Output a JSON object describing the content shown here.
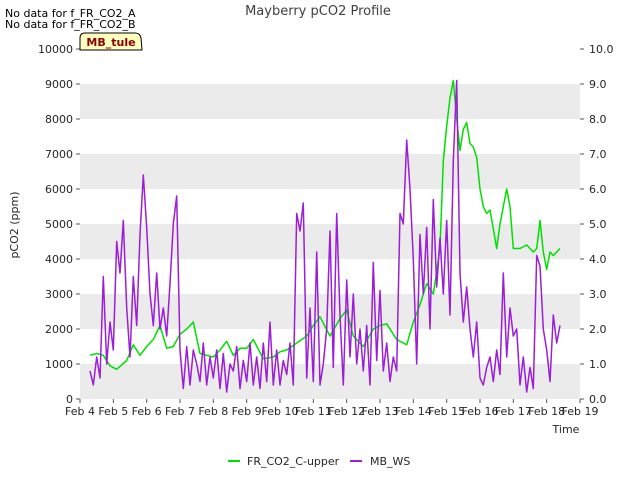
{
  "notices": [
    "No data for f_FR_CO2_A",
    "No data for f_FR_CO2_B"
  ],
  "site_label": "MB_tule",
  "chart_data": {
    "type": "line",
    "title": "Mayberry pCO2 Profile",
    "xlabel": "Time",
    "ylabel": "pCO2 (ppm)",
    "ylim": [
      0,
      10000
    ],
    "y2lim": [
      0.0,
      10.0
    ],
    "xlim": [
      4,
      19
    ],
    "x_ticks": [
      4,
      5,
      6,
      7,
      8,
      9,
      10,
      11,
      12,
      13,
      14,
      15,
      16,
      17,
      18,
      19
    ],
    "x_tick_labels": [
      "Feb 4",
      "Feb 5",
      "Feb 6",
      "Feb 7",
      "Feb 8",
      "Feb 9",
      "Feb 10",
      "Feb 11",
      "Feb 12",
      "Feb 13",
      "Feb 14",
      "Feb 15",
      "Feb 16",
      "Feb 17",
      "Feb 18",
      "Feb 19"
    ],
    "y_ticks": [
      0,
      1000,
      2000,
      3000,
      4000,
      5000,
      6000,
      7000,
      8000,
      9000,
      10000
    ],
    "y_tick_labels": [
      "0",
      "1000",
      "2000",
      "3000",
      "4000",
      "5000",
      "6000",
      "7000",
      "8000",
      "9000",
      "10000"
    ],
    "y2_ticks": [
      0,
      1,
      2,
      3,
      4,
      5,
      6,
      7,
      8,
      9,
      10
    ],
    "y2_tick_labels": [
      "0.0",
      "1.0",
      "2.0",
      "3.0",
      "4.0",
      "5.0",
      "6.0",
      "7.0",
      "8.0",
      "9.0",
      "10.0"
    ],
    "grid": "horizontal bands",
    "legend": "bottom",
    "colors": {
      "FR_CO2_C-upper": "#00e000",
      "MB_WS": "#9a1fd6",
      "band": "#ebebeb"
    },
    "series": [
      {
        "name": "FR_CO2_C-upper",
        "axis": "left",
        "x": [
          4.3,
          4.5,
          4.7,
          4.9,
          5.1,
          5.4,
          5.6,
          5.8,
          6.0,
          6.2,
          6.4,
          6.6,
          6.8,
          7.0,
          7.2,
          7.4,
          7.6,
          7.8,
          8.0,
          8.2,
          8.4,
          8.6,
          8.8,
          9.0,
          9.2,
          9.5,
          9.8,
          10.0,
          10.2,
          10.5,
          10.8,
          11.0,
          11.2,
          11.5,
          11.8,
          12.0,
          12.2,
          12.5,
          12.8,
          13.0,
          13.2,
          13.5,
          13.8,
          14.0,
          14.2,
          14.4,
          14.6,
          14.8,
          14.9,
          15.0,
          15.1,
          15.2,
          15.3,
          15.4,
          15.5,
          15.6,
          15.7,
          15.8,
          15.9,
          16.0,
          16.1,
          16.2,
          16.3,
          16.5,
          16.6,
          16.8,
          16.9,
          17.0,
          17.2,
          17.4,
          17.6,
          17.7,
          17.8,
          17.9,
          18.0,
          18.1,
          18.2,
          18.4
        ],
        "y": [
          1250,
          1300,
          1250,
          950,
          850,
          1100,
          1550,
          1250,
          1500,
          1700,
          2100,
          1450,
          1500,
          1850,
          2000,
          2200,
          1300,
          1250,
          1200,
          1400,
          1650,
          1250,
          1450,
          1450,
          1700,
          1150,
          1200,
          1350,
          1400,
          1600,
          1800,
          2100,
          2350,
          1800,
          2300,
          2550,
          1800,
          1500,
          2000,
          2100,
          2150,
          1700,
          1550,
          2200,
          2700,
          3300,
          3000,
          4300,
          6800,
          7800,
          8600,
          9100,
          8000,
          7100,
          7700,
          7900,
          7300,
          7200,
          6900,
          6000,
          5500,
          5300,
          5400,
          4300,
          5000,
          6000,
          5500,
          4300,
          4300,
          4400,
          4200,
          4300,
          5100,
          4200,
          3700,
          4200,
          4100,
          4300
        ]
      },
      {
        "name": "MB_WS",
        "axis": "right",
        "x": [
          4.3,
          4.4,
          4.5,
          4.6,
          4.7,
          4.8,
          4.9,
          5.0,
          5.1,
          5.2,
          5.3,
          5.4,
          5.5,
          5.6,
          5.7,
          5.8,
          5.9,
          6.0,
          6.1,
          6.2,
          6.3,
          6.4,
          6.5,
          6.6,
          6.7,
          6.8,
          6.9,
          7.0,
          7.1,
          7.2,
          7.3,
          7.4,
          7.5,
          7.6,
          7.7,
          7.8,
          7.9,
          8.0,
          8.1,
          8.2,
          8.3,
          8.4,
          8.5,
          8.6,
          8.7,
          8.8,
          8.9,
          9.0,
          9.1,
          9.2,
          9.3,
          9.4,
          9.5,
          9.6,
          9.7,
          9.8,
          9.9,
          10.0,
          10.1,
          10.2,
          10.3,
          10.4,
          10.5,
          10.6,
          10.7,
          10.8,
          10.9,
          11.0,
          11.1,
          11.2,
          11.3,
          11.4,
          11.5,
          11.6,
          11.7,
          11.8,
          11.9,
          12.0,
          12.1,
          12.2,
          12.3,
          12.4,
          12.5,
          12.6,
          12.7,
          12.8,
          12.9,
          13.0,
          13.1,
          13.2,
          13.3,
          13.4,
          13.5,
          13.6,
          13.7,
          13.8,
          13.9,
          14.0,
          14.1,
          14.2,
          14.3,
          14.4,
          14.5,
          14.6,
          14.7,
          14.8,
          14.9,
          15.0,
          15.1,
          15.2,
          15.3,
          15.4,
          15.5,
          15.6,
          15.7,
          15.8,
          15.9,
          16.0,
          16.1,
          16.2,
          16.3,
          16.4,
          16.5,
          16.6,
          16.7,
          16.8,
          16.9,
          17.0,
          17.1,
          17.2,
          17.3,
          17.4,
          17.5,
          17.6,
          17.7,
          17.8,
          17.9,
          18.0,
          18.1,
          18.2,
          18.3,
          18.4
        ],
        "y": [
          0.8,
          0.4,
          1.2,
          0.6,
          3.5,
          1.0,
          2.2,
          1.4,
          4.5,
          3.6,
          5.1,
          2.6,
          1.2,
          3.5,
          2.1,
          4.7,
          6.4,
          4.9,
          3.0,
          2.1,
          3.6,
          2.0,
          2.6,
          1.8,
          3.3,
          5.0,
          5.8,
          1.4,
          0.3,
          1.5,
          0.4,
          1.4,
          1.0,
          0.5,
          1.6,
          0.4,
          1.2,
          0.6,
          1.4,
          0.3,
          1.3,
          0.2,
          1.0,
          0.8,
          1.5,
          0.3,
          1.1,
          0.5,
          1.6,
          0.4,
          1.2,
          0.3,
          1.6,
          0.5,
          2.2,
          0.4,
          1.4,
          0.4,
          1.1,
          0.7,
          1.6,
          0.4,
          5.3,
          4.8,
          5.6,
          0.6,
          2.6,
          0.5,
          4.2,
          0.4,
          1.0,
          2.0,
          4.8,
          0.9,
          5.3,
          2.4,
          0.4,
          3.4,
          1.2,
          3.0,
          1.0,
          2.0,
          0.8,
          2.1,
          0.4,
          3.9,
          1.1,
          3.1,
          0.8,
          1.6,
          0.5,
          1.2,
          0.8,
          5.3,
          5.0,
          7.4,
          6.0,
          4.0,
          1.0,
          4.7,
          3.0,
          4.9,
          2.0,
          5.7,
          3.2,
          4.6,
          3.0,
          5.1,
          2.4,
          6.8,
          9.1,
          3.6,
          2.2,
          3.2,
          2.0,
          1.2,
          2.2,
          0.6,
          0.4,
          0.9,
          1.2,
          0.5,
          1.4,
          0.7,
          3.6,
          1.2,
          2.6,
          1.8,
          2.0,
          0.4,
          1.2,
          0.2,
          0.9,
          0.3,
          4.1,
          3.8,
          2.0,
          1.4,
          0.5,
          2.4,
          1.6,
          2.1
        ]
      }
    ]
  }
}
